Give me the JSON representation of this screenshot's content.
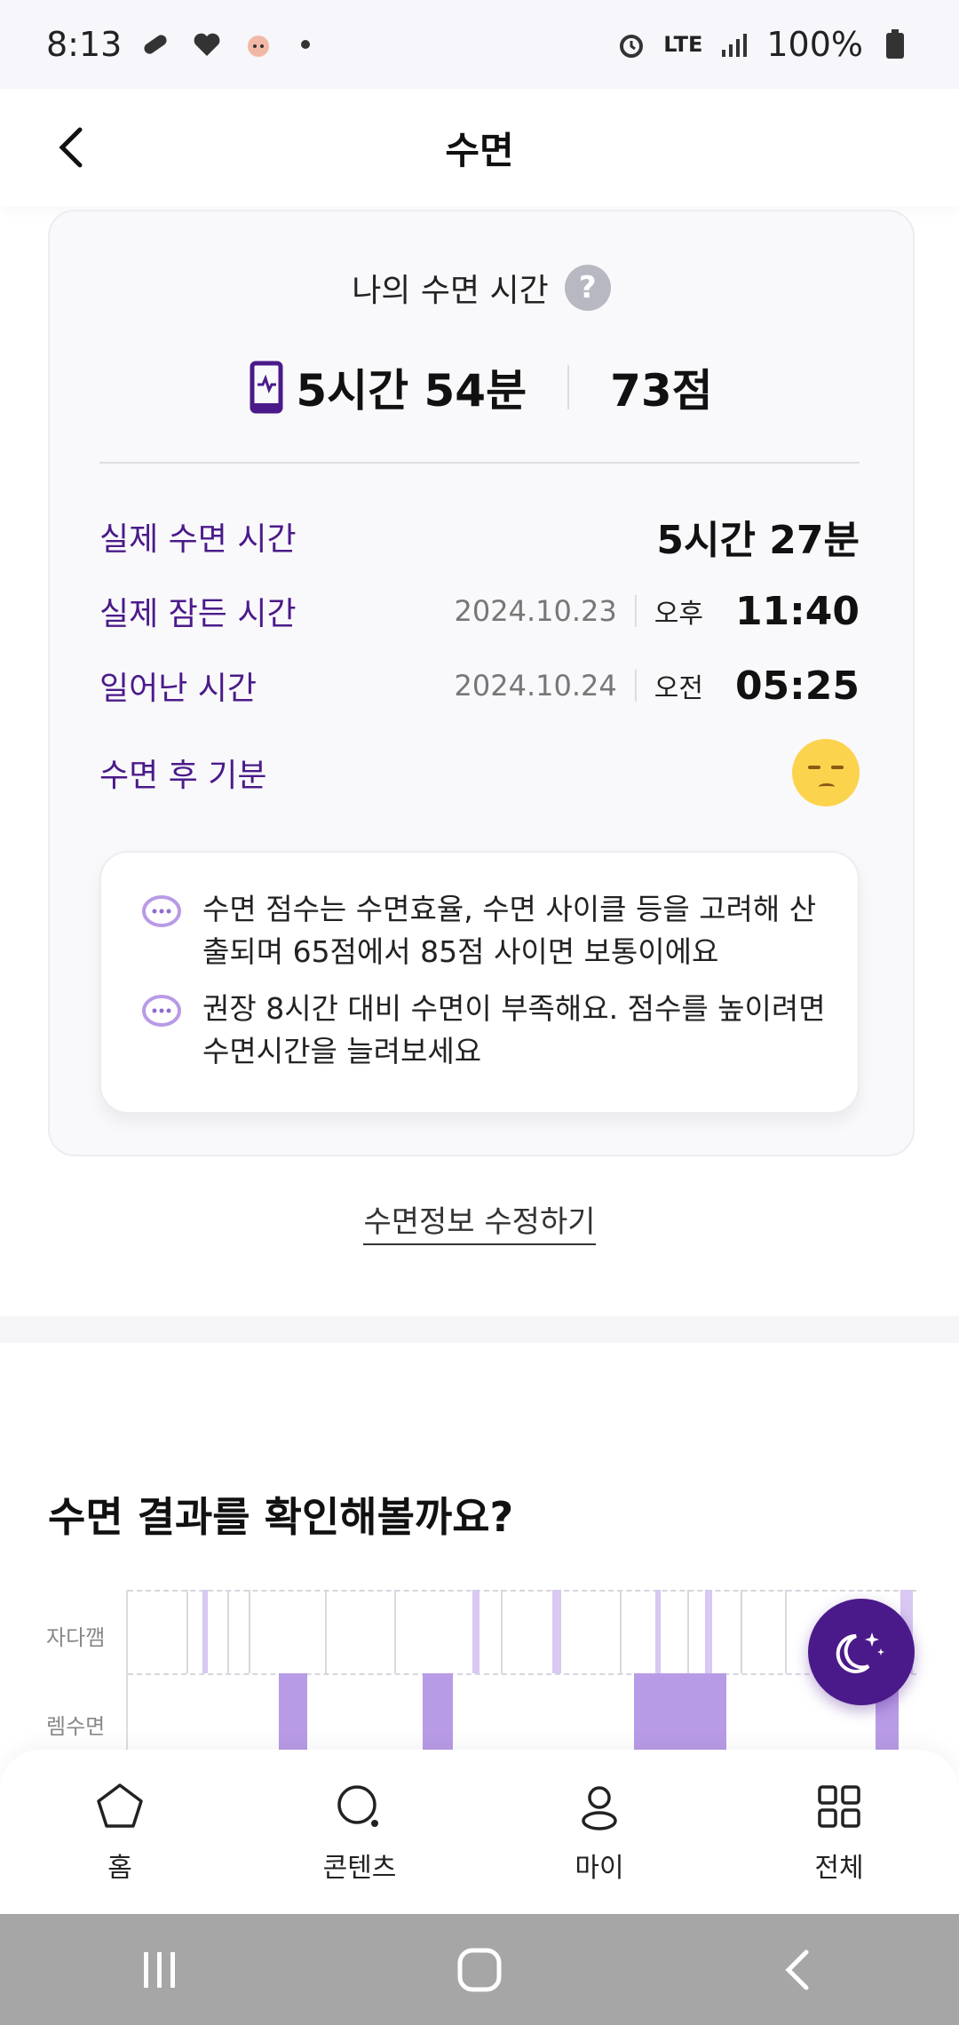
{
  "status_bar": {
    "time": "8:13",
    "network": "LTE",
    "battery": "100%"
  },
  "header": {
    "title": "수면"
  },
  "sleep_card": {
    "title": "나의 수면 시간",
    "help": "?",
    "duration": "5시간 54분",
    "score": "73점",
    "actual_sleep_label": "실제 수면 시간",
    "actual_sleep_value": "5시간 27분",
    "fell_asleep_label": "실제 잠든 시간",
    "fell_asleep_date": "2024.10.23",
    "fell_asleep_ampm": "오후",
    "fell_asleep_time": "11:40",
    "woke_label": "일어난 시간",
    "woke_date": "2024.10.24",
    "woke_ampm": "오전",
    "woke_time": "05:25",
    "mood_label": "수면 후 기분",
    "mood_icon": "sleepy-face-icon",
    "tips": [
      "수면 점수는 수면효율, 수면 사이클 등을 고려해 산출되며 65점에서 85점 사이면 보통이에요",
      "권장 8시간 대비 수면이 부족해요. 점수를 높이려면 수면시간을 늘려보세요"
    ]
  },
  "edit_link": "수면정보 수정하기",
  "results": {
    "title": "수면 결과를 확인해볼까요?",
    "stage_labels": [
      "자다깸",
      "렘수면"
    ]
  },
  "bottom_nav": {
    "items": [
      {
        "label": "홈",
        "icon": "home-pentagon-icon"
      },
      {
        "label": "콘텐츠",
        "icon": "search-icon"
      },
      {
        "label": "마이",
        "icon": "person-icon"
      },
      {
        "label": "전체",
        "icon": "grid-icon"
      }
    ]
  },
  "colors": {
    "accent": "#4b1a8a",
    "label_purple": "#4b1a8a",
    "stage_fill": "#b89be6",
    "card_bg": "#f9f9fb",
    "mood_yellow": "#fcd34d"
  }
}
